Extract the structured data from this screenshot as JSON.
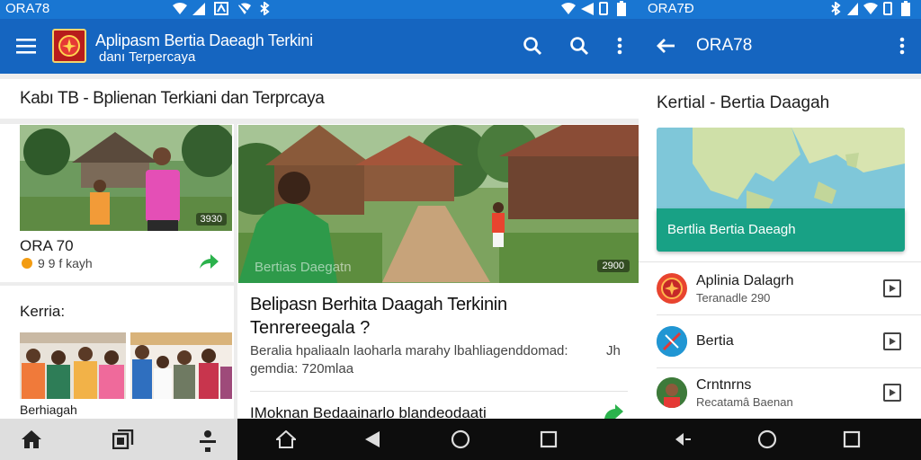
{
  "left_status": {
    "time": "ORA78"
  },
  "right_status": {
    "time": "ORA7Đ"
  },
  "left_appbar": {
    "title_line1": "Aplipasm Bertia Daeagh Terkini",
    "title_line2": "danı Terpercaya"
  },
  "left_content": {
    "header": "Kabı TB - Bplienan Terkiani dan Terprcaya",
    "card1": {
      "badge": "3930",
      "title": "ORA 70",
      "meta": "9 9 f kayh"
    },
    "card2": {
      "title": "Kerria:",
      "caption": "Berhiagah"
    },
    "featured": {
      "watermark": "Bertias Daegatn",
      "badge": "2900",
      "title_line1": "Belipasn Berhita Daagah Terkinin",
      "title_line2": "Tenrereegala ?",
      "desc_line1": "Beralia hpaliaaln laoharla marahy lbahliagenddomad:",
      "desc_suffix": "Jh",
      "desc_line2": "gemdia: 720mlaa",
      "next_title": "IMoknan Bedaainarlo blandeodaati"
    }
  },
  "right_appbar": {
    "title": "ORA78"
  },
  "right_content": {
    "header": "Kertial - Bertia Daagah",
    "map_banner": "Bertlia Bertia Daeagh",
    "list": [
      {
        "title": "Aplinia Dalagrh",
        "subtitle": "Teranadle 290"
      },
      {
        "title": "Bertia",
        "subtitle": ""
      },
      {
        "title": "Crntnrns",
        "subtitle": "Recatamâ Baenan"
      }
    ]
  },
  "colors": {
    "status_bar": "#1976d2",
    "app_bar": "#1565c0",
    "nav_bar": "#0d0d0d",
    "accent_green": "#2bb24c",
    "map_banner": "#18a185"
  },
  "icons": {
    "left_appbar": [
      "menu-icon",
      "app-logo",
      "search-icon",
      "search-icon",
      "more-vert-icon"
    ],
    "right_appbar": [
      "back-arrow-icon",
      "more-vert-icon"
    ],
    "left_bottom_nav": [
      "home-icon",
      "bookmarks-icon",
      "person-icon"
    ],
    "system_nav": [
      "home-outline-icon",
      "back-icon",
      "circle-home-icon",
      "square-recents-icon"
    ]
  }
}
